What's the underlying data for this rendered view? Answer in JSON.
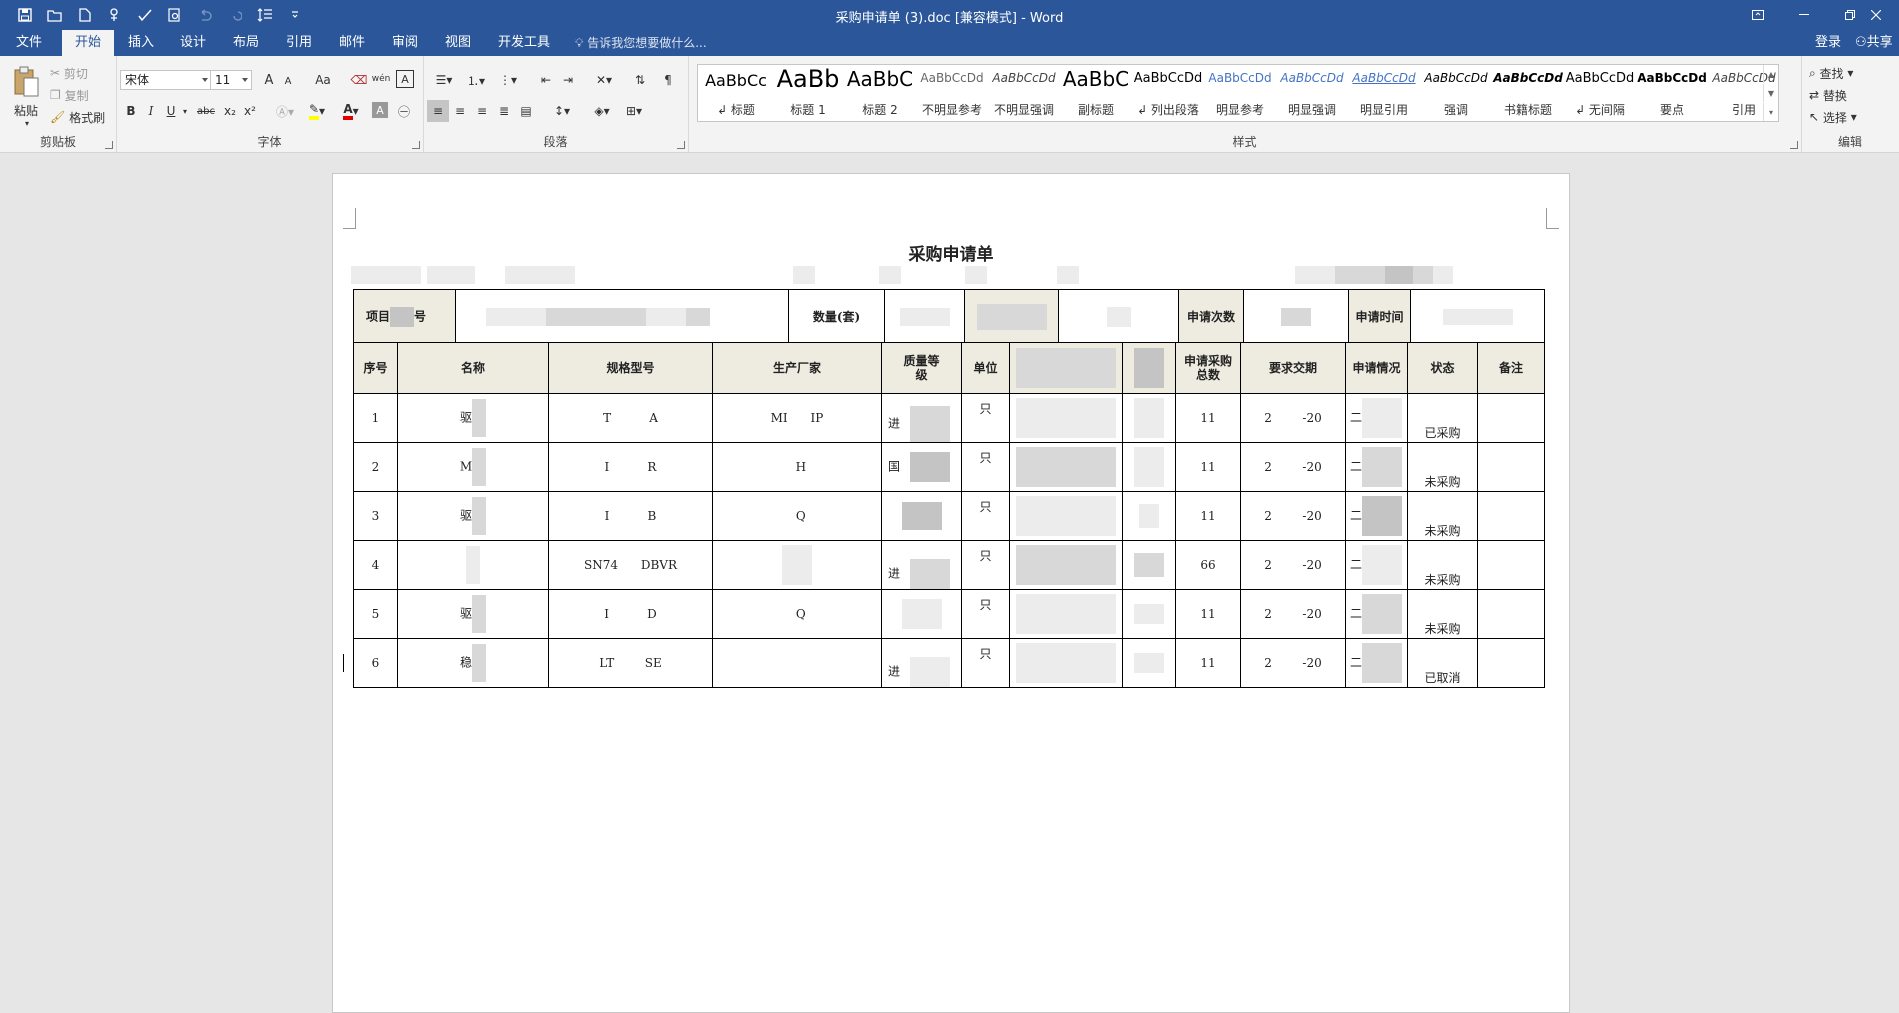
{
  "window": {
    "title": "采购申请单 (3).doc [兼容模式] - Word"
  },
  "tabs": [
    {
      "label": "文件",
      "active": false
    },
    {
      "label": "开始",
      "active": true
    },
    {
      "label": "插入",
      "active": false
    },
    {
      "label": "设计",
      "active": false
    },
    {
      "label": "布局",
      "active": false
    },
    {
      "label": "引用",
      "active": false
    },
    {
      "label": "邮件",
      "active": false
    },
    {
      "label": "审阅",
      "active": false
    },
    {
      "label": "视图",
      "active": false
    },
    {
      "label": "开发工具",
      "active": false
    }
  ],
  "tell_me": {
    "placeholder": "告诉我您想要做什么..."
  },
  "account": {
    "login": "登录",
    "share": "共享"
  },
  "clipboard": {
    "paste": "粘贴",
    "cut": "剪切",
    "copy": "复制",
    "format_painter": "格式刷",
    "label": "剪贴板"
  },
  "font": {
    "name": "宋体",
    "size": "11",
    "label": "字体",
    "bold": "B",
    "italic": "I",
    "underline": "U",
    "strike": "abc",
    "sub": "x₂",
    "sup": "x²",
    "grow": "A",
    "shrink": "A",
    "case": "Aa",
    "phonetic": "wén",
    "border": "A"
  },
  "paragraph": {
    "label": "段落"
  },
  "styles": {
    "label": "样式",
    "items": [
      {
        "sample": "AaBbCc",
        "name": "↲ 标题"
      },
      {
        "sample": "AaBb",
        "name": "标题 1"
      },
      {
        "sample": "AaBbC",
        "name": "标题 2"
      },
      {
        "sample": "AaBbCcDd",
        "name": "不明显参考"
      },
      {
        "sample": "AaBbCcDd",
        "name": "不明显强调"
      },
      {
        "sample": "AaBbC",
        "name": "副标题"
      },
      {
        "sample": "AaBbCcDd",
        "name": "↲ 列出段落"
      },
      {
        "sample": "AaBbCcDd",
        "name": "明显参考"
      },
      {
        "sample": "AaBbCcDd",
        "name": "明显强调"
      },
      {
        "sample": "AaBbCcDd",
        "name": "明显引用"
      },
      {
        "sample": "AaBbCcDd",
        "name": "强调"
      },
      {
        "sample": "AaBbCcDd",
        "name": "书籍标题"
      },
      {
        "sample": "AaBbCcDd",
        "name": "↲ 无间隔"
      },
      {
        "sample": "AaBbCcDd",
        "name": "要点"
      },
      {
        "sample": "AaBbCcDd",
        "name": "引用"
      }
    ]
  },
  "editing": {
    "find": "查找",
    "replace": "替换",
    "select": "选择",
    "label": "编辑"
  },
  "document": {
    "heading": "采购申请单",
    "info": {
      "project_label_a": "项目",
      "project_label_b": "号",
      "quantity_label": "数量(套)",
      "count_label": "申请次数",
      "time_label": "申请时间"
    },
    "headers": [
      "序号",
      "名称",
      "规格型号",
      "生产厂家",
      "质量等级",
      "单位",
      "",
      "",
      "申请采购总数",
      "要求交期",
      "申请情况",
      "状态",
      "备注"
    ],
    "rows": [
      {
        "no": "1",
        "name": "驱",
        "model": "T          A",
        "maker": "MI      IP",
        "quality": "进",
        "unit": "只",
        "total": "11",
        "due": "2        -20",
        "apply": "二",
        "status": "已采购"
      },
      {
        "no": "2",
        "name": "M",
        "model": "I          R",
        "maker": "  H",
        "quality": "国",
        "unit": "只",
        "total": "11",
        "due": "2        -20",
        "apply": "二",
        "status": "未采购"
      },
      {
        "no": "3",
        "name": "驱",
        "model": "I          B",
        "maker": "  Q",
        "quality": "",
        "unit": "只",
        "total": "11",
        "due": "2        -20",
        "apply": "二",
        "status": "未采购"
      },
      {
        "no": "4",
        "name": "",
        "model": "SN74      DBVR",
        "maker": "",
        "quality": "进",
        "unit": "只",
        "total": "66",
        "due": "2        -20",
        "apply": "二",
        "status": "未采购"
      },
      {
        "no": "5",
        "name": "驱",
        "model": "I          D",
        "maker": "  Q",
        "quality": "",
        "unit": "只",
        "total": "11",
        "due": "2        -20",
        "apply": "二",
        "status": "未采购"
      },
      {
        "no": "6",
        "name": "稳",
        "model": "LT        SE",
        "maker": "",
        "quality": "进",
        "unit": "只",
        "total": "11",
        "due": "2        -20",
        "apply": "二",
        "status": "已取消"
      }
    ]
  }
}
